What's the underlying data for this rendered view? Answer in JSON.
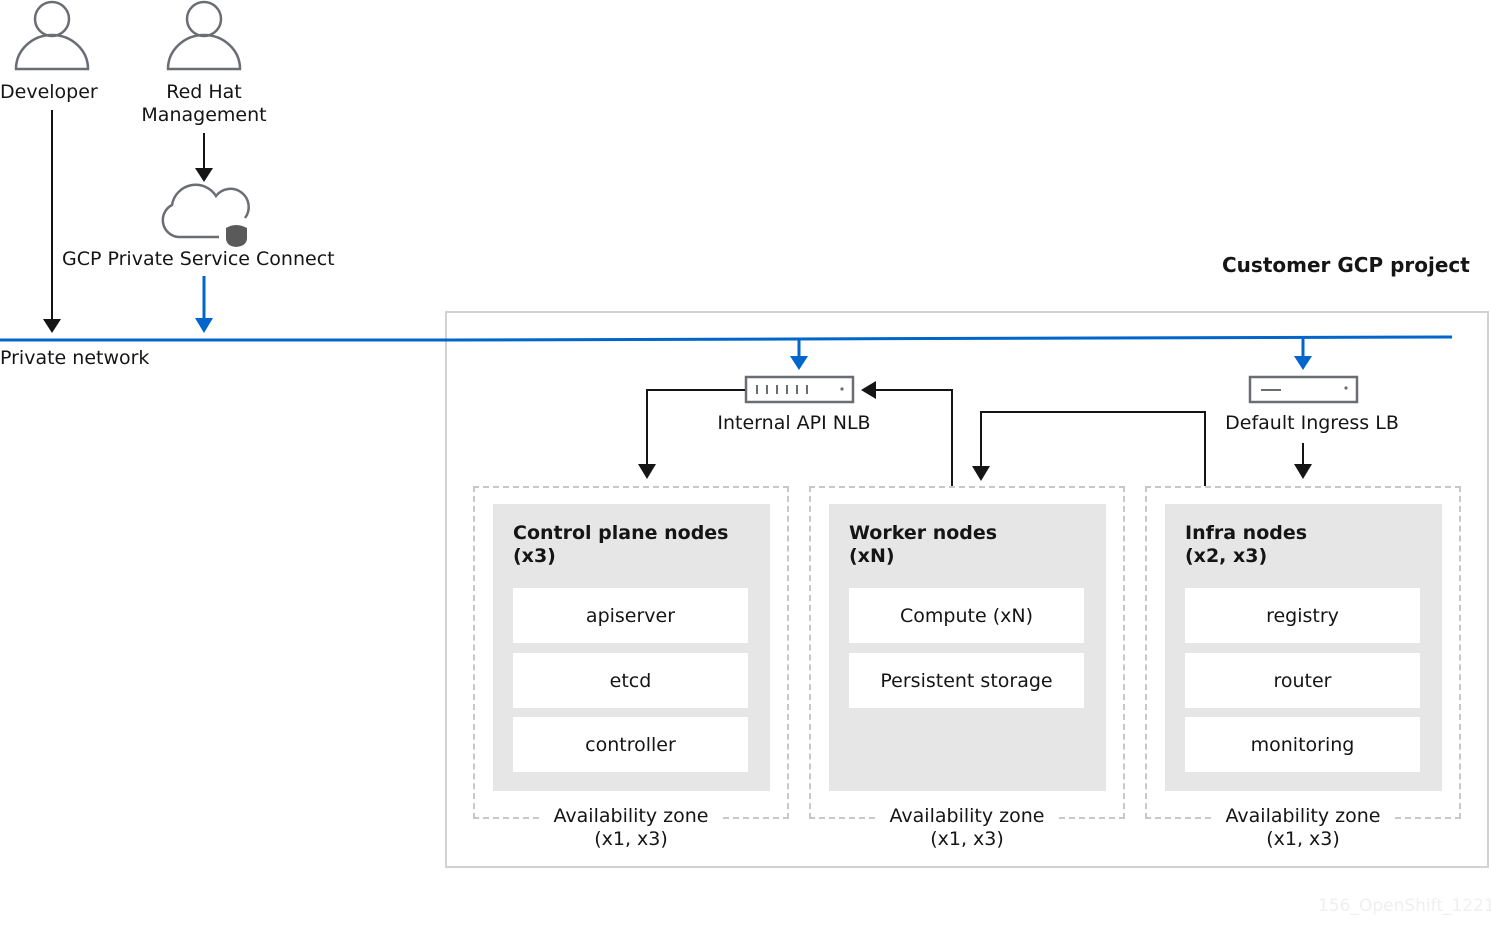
{
  "actors": {
    "developer": "Developer",
    "redhat_line1": "Red Hat",
    "redhat_line2": "Management"
  },
  "psc": {
    "label": "GCP Private Service Connect",
    "icon": "cloud-shield-icon"
  },
  "network": {
    "label": "Private network",
    "color": "#0066cc"
  },
  "project": {
    "title": "Customer GCP project"
  },
  "load_balancers": {
    "internal": {
      "label": "Internal API NLB",
      "icon": "load-balancer-icon"
    },
    "ingress": {
      "label": "Default Ingress LB",
      "icon": "load-balancer-icon"
    }
  },
  "zones": [
    {
      "title_line1": "Control plane nodes",
      "title_line2": "(x3)",
      "components": [
        "apiserver",
        "etcd",
        "controller"
      ],
      "az_line1": "Availability zone",
      "az_line2": "(x1, x3)"
    },
    {
      "title_line1": "Worker nodes",
      "title_line2": "(xN)",
      "components": [
        "Compute (xN)",
        "Persistent storage"
      ],
      "az_line1": "Availability zone",
      "az_line2": "(x1, x3)"
    },
    {
      "title_line1": "Infra nodes",
      "title_line2": "(x2, x3)",
      "components": [
        "registry",
        "router",
        "monitoring"
      ],
      "az_line1": "Availability zone",
      "az_line2": "(x1, x3)"
    }
  ],
  "watermark": "156_OpenShift_1221"
}
